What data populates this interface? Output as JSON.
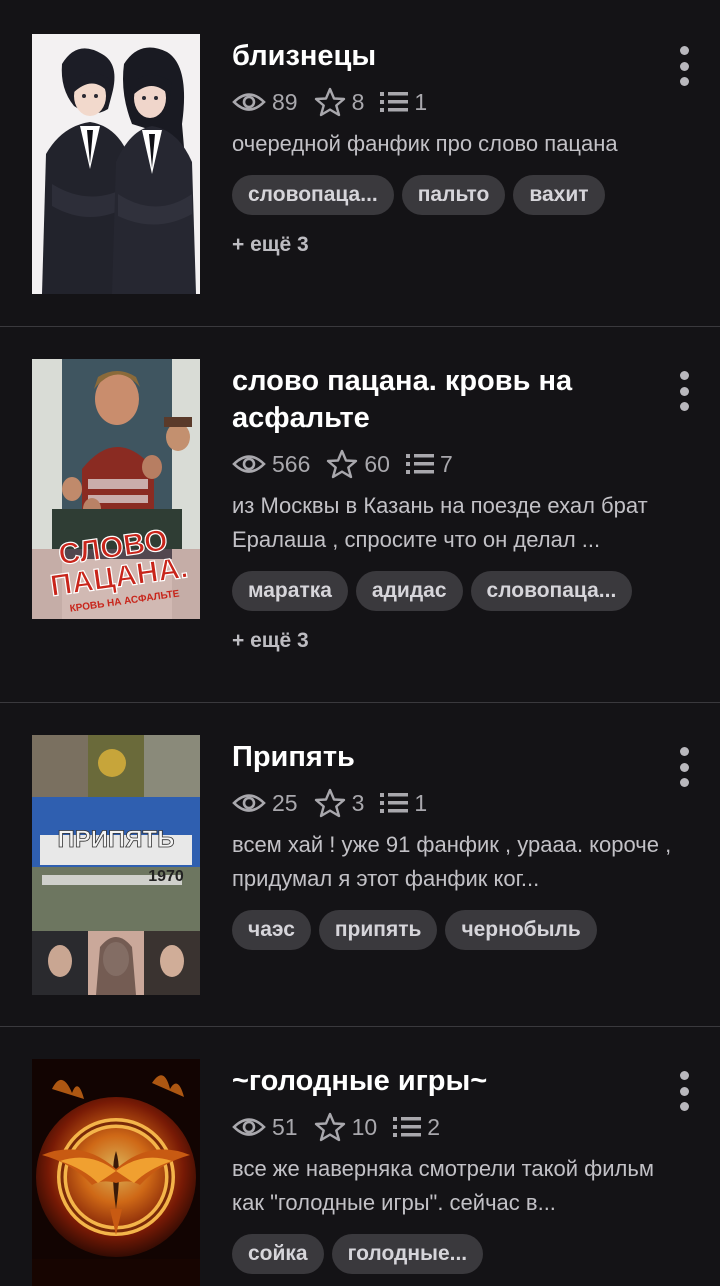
{
  "colors": {
    "background": "#141316",
    "tag_background": "#3a393d",
    "meta_text": "#a9a8ad"
  },
  "icons": {
    "views": "eye-icon",
    "likes": "star-icon",
    "parts": "list-icon",
    "menu": "more-vertical-icon"
  },
  "works": [
    {
      "title": "близнецы",
      "views": "89",
      "likes": "8",
      "parts": "1",
      "description": "очередной фанфик про слово пацана",
      "tags": [
        "словопаца...",
        "пальто",
        "вахит"
      ],
      "more_tags": "+ ещё 3"
    },
    {
      "title": "слово пацана. кровь на асфальте",
      "views": "566",
      "likes": "60",
      "parts": "7",
      "description": "из Москвы в Казань на поезде ехал брат Ералаша , спросите что он делал ...",
      "tags": [
        "маратка",
        "адидас",
        "словопаца..."
      ],
      "more_tags": "+ ещё 3"
    },
    {
      "title": "Припять",
      "views": "25",
      "likes": "3",
      "parts": "1",
      "description": "всем хай ! уже 91 фанфик , урааа. короче , придумал я этот фанфик ког...",
      "tags": [
        "чаэс",
        "припять",
        "чернобыль"
      ],
      "cover_text": "ПРИПЯТЬ",
      "cover_year": "1970"
    },
    {
      "title": "~голодные игры~",
      "views": "51",
      "likes": "10",
      "parts": "2",
      "description": "все же наверняка смотрели такой фильм как \"голодные игры\". сейчас в...",
      "tags": [
        "сойка",
        "голодные..."
      ]
    }
  ],
  "covers": {
    "work2_title_line1": "СЛОВО",
    "work2_title_line2": "ПАЦАНА.",
    "work2_subtitle": "КРОВЬ НА АСФАЛЬТЕ"
  }
}
